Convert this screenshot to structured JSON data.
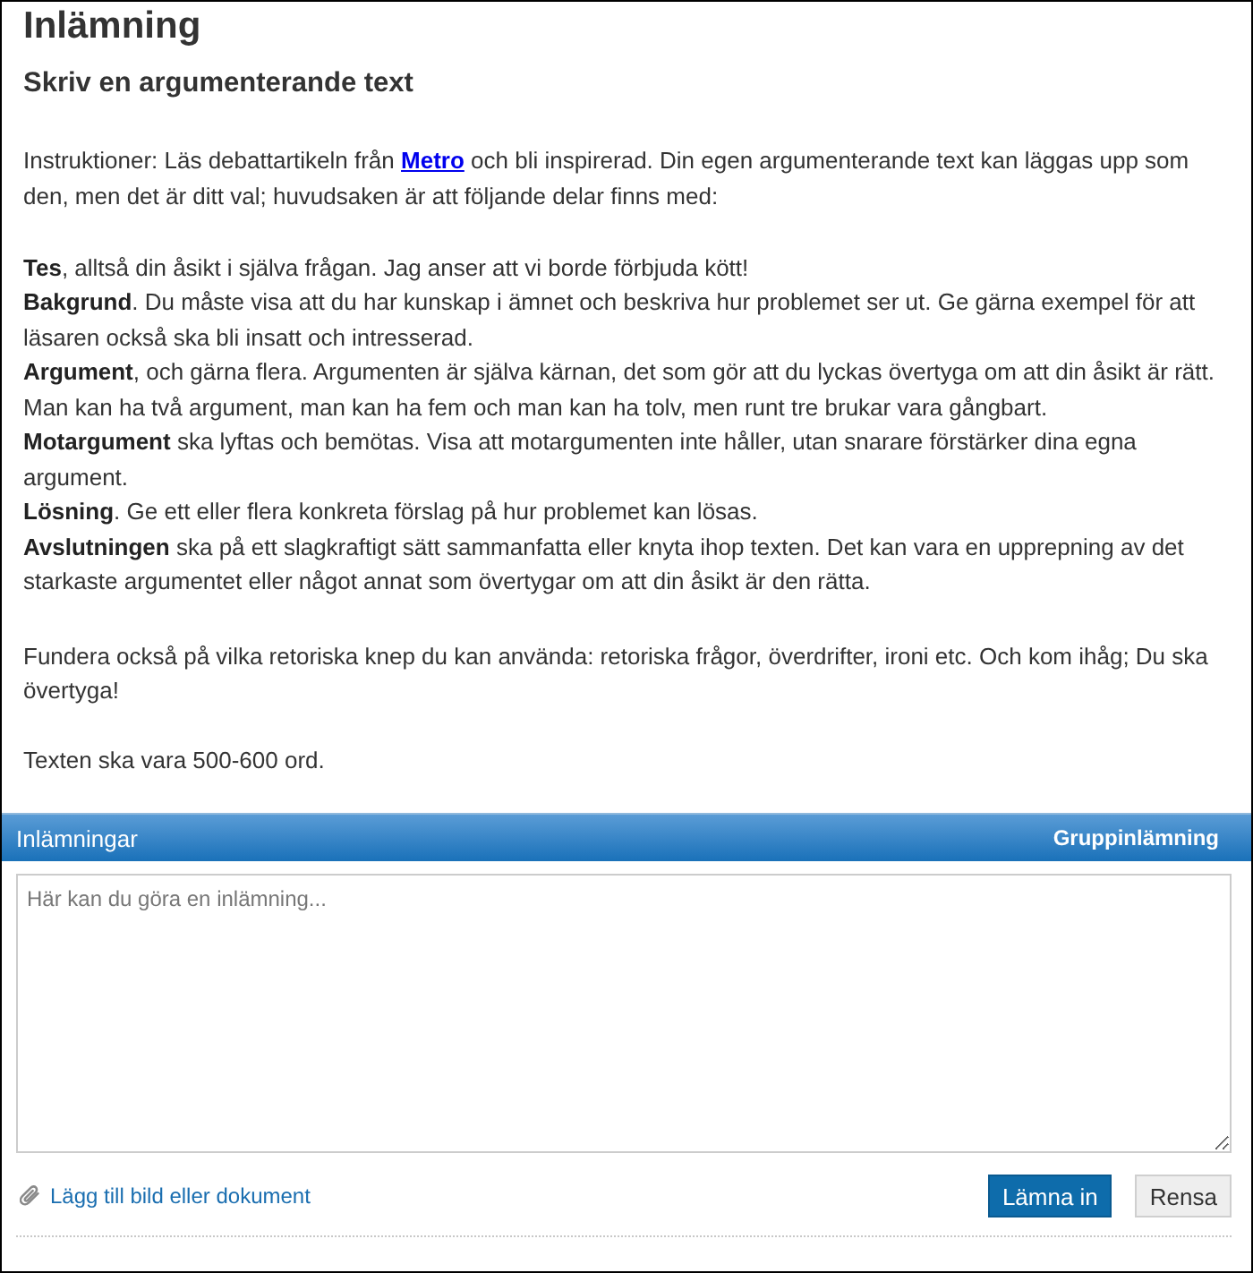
{
  "page": {
    "title": "Inlämning",
    "subtitle": "Skriv en argumenterande text"
  },
  "intro": {
    "before": "Instruktioner: Läs debattartikeln från ",
    "link": "Metro",
    "after": " och bli inspirerad. Din egen argumenterande text kan läggas upp som den, men det är ditt val; huvudsaken är att följande delar finns med:"
  },
  "parts": [
    "**Tes**, alltså din åsikt i själva frågan. Jag anser att vi borde förbjuda kött!",
    "**Bakgrund**. Du måste visa att du har kunskap i ämnet och beskriva hur problemet ser ut. Ge gärna exempel för att läsaren också ska bli insatt och intresserad.",
    "**Argument**, och gärna flera. Argumenten är själva kärnan, det som gör att du lyckas övertyga om att din åsikt är rätt. Man kan ha två argument, man kan ha fem och man kan ha tolv, men runt tre brukar vara gångbart.",
    "**Motargument** ska lyftas och bemötas. Visa att motargumenten inte håller, utan snarare förstärker dina egna argument.",
    "**Lösning**. Ge ett eller flera konkreta förslag på hur problemet kan lösas.",
    "**Avslutningen** ska på ett slagkraftigt sätt sammanfatta eller knyta ihop texten. Det kan vara en upprepning av det starkaste argumentet eller något annat som övertygar om att din åsikt är den rätta."
  ],
  "notes": [
    "Fundera också på vilka retoriska knep du kan använda: retoriska frågor, överdrifter, ironi etc. Och kom ihåg; Du ska övertyga!",
    "Texten ska vara 500-600 ord."
  ],
  "submission": {
    "title": "Inlämningar",
    "group_label": "Gruppinlämning",
    "placeholder": "Här kan du göra en inlämning...",
    "attach_link": "Lägg till bild eller dokument",
    "buttons": [
      {
        "label": "Lämna in",
        "kind": "primary"
      },
      {
        "label": "Rensa",
        "kind": "secondary"
      }
    ]
  }
}
